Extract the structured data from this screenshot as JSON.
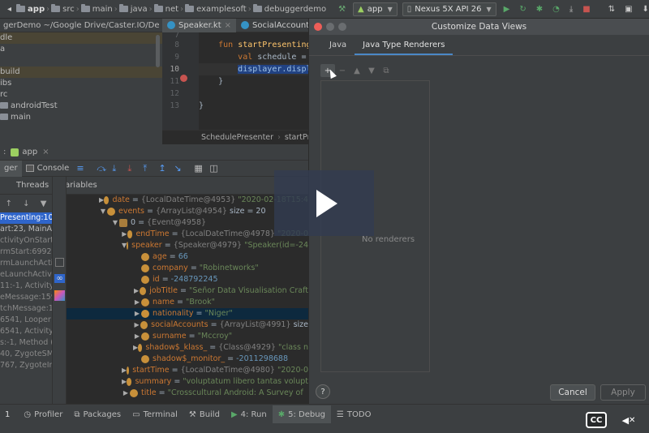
{
  "breadcrumb": [
    "app",
    "src",
    "main",
    "java",
    "net",
    "examplesoft",
    "debuggerdemo"
  ],
  "toolbar": {
    "run_config": "app",
    "device": "Nexus 5X API 26"
  },
  "project": {
    "header": "gerDemo ~/Google Drive/Caster.IO/Debug",
    "rows": [
      "dle",
      "a",
      "",
      "build",
      "ibs",
      "rc",
      "androidTest",
      "main"
    ]
  },
  "editor": {
    "tabs": [
      "Speaker.kt",
      "SocialAccount.kt"
    ],
    "line_numbers": [
      "7",
      "8",
      "9",
      "10",
      "11",
      "12",
      "13"
    ],
    "lines": {
      "l8_kw": "fun ",
      "l8_fn": "startPresenting",
      "l9_kw": "val ",
      "l9_rest": "schedule =",
      "l10_sel": "displayer.displ",
      "l11": "}",
      "l13": "}"
    },
    "breadcrumbs": [
      "SchedulePresenter",
      "startPre"
    ]
  },
  "debug": {
    "tool_label": "app",
    "tabs": [
      "ger",
      "Console"
    ],
    "frames_label": "Threads",
    "vars_label": "Variables",
    "frames": [
      "Presenting:10,",
      "art:23, MainAct",
      "ctivityOnStart:",
      "rmStart:6992,",
      "rmLaunchActiv",
      "eLaunchActivi",
      "11:-1, Activity",
      "eMessage:159",
      "tchMessage:10",
      "6541, Looper (a",
      "6541, ActivityT",
      "s:-1, Method (",
      "40, ZygoteSM",
      "767, ZygoteIni"
    ],
    "variables": [
      {
        "name": "date",
        "type": "{LocalDateTime@4953}",
        "value": "\"2020-02-18T15:4"
      },
      {
        "name": "events",
        "type": "{ArrayList@4954}",
        "value": "size = 20"
      },
      {
        "name": "0",
        "type": "{Event@4958}",
        "value": ""
      },
      {
        "name": "endTime",
        "type": "{LocalDateTime@4978}",
        "value": "\"2020-0"
      },
      {
        "name": "speaker",
        "type": "{Speaker@4979}",
        "value": "\"Speaker(id=-24"
      },
      {
        "name": "age",
        "type": "",
        "value": "66"
      },
      {
        "name": "company",
        "type": "",
        "value": "\"Robinetworks\""
      },
      {
        "name": "id",
        "type": "",
        "value": "-248792245"
      },
      {
        "name": "jobTitle",
        "type": "",
        "value": "\"Señor Data Visualisation Craft"
      },
      {
        "name": "name",
        "type": "",
        "value": "\"Brook\""
      },
      {
        "name": "nationality",
        "type": "",
        "value": "\"Niger\""
      },
      {
        "name": "socialAccounts",
        "type": "{ArrayList@4991}",
        "value": "size"
      },
      {
        "name": "surname",
        "type": "",
        "value": "\"Mccroy\""
      },
      {
        "name": "shadow$_klass_",
        "type": "{Class@4929}",
        "value": "\"class n"
      },
      {
        "name": "shadow$_monitor_",
        "type": "",
        "value": "-2011298688"
      },
      {
        "name": "startTime",
        "type": "{LocalDateTime@4980}",
        "value": "\"2020-0"
      },
      {
        "name": "summary",
        "type": "",
        "value": "\"voluptatum libero tantas volupt"
      },
      {
        "name": "title",
        "type": "",
        "value": "\"Crosscultural Android: A Survey of"
      }
    ]
  },
  "bottom_tabs": [
    "Profiler",
    "Packages",
    "Terminal",
    "Build",
    "4: Run",
    "5: Debug",
    "TODO"
  ],
  "status_left": "1",
  "dialog": {
    "title": "Customize Data Views",
    "tabs": [
      "Java",
      "Java Type Renderers"
    ],
    "empty_text": "No renderers",
    "help": "?",
    "cancel": "Cancel",
    "apply": "Apply"
  },
  "video": {
    "cc": "CC",
    "mute": "✕"
  }
}
